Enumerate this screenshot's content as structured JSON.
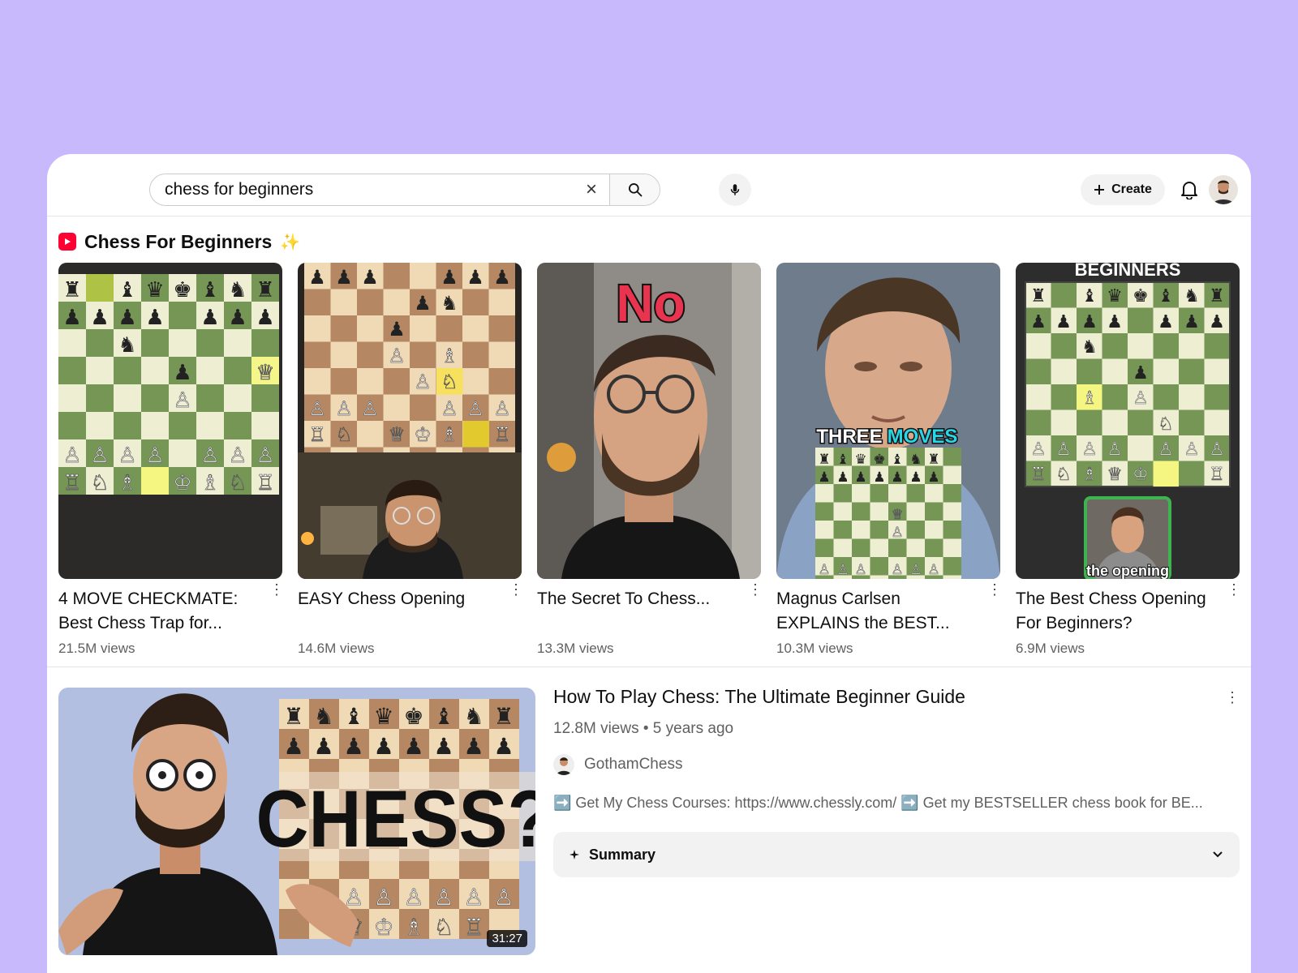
{
  "search": {
    "value": "chess for beginners",
    "clear_icon": "×"
  },
  "header": {
    "create_label": "Create"
  },
  "shelf": {
    "title": "Chess For Beginners",
    "sparkle": "✨",
    "items": [
      {
        "title": "4 MOVE CHECKMATE: Best Chess Trap for...",
        "views": "21.5M views"
      },
      {
        "title": "EASY Chess Opening",
        "views": "14.6M views"
      },
      {
        "title": "The Secret To Chess...",
        "views": "13.3M views",
        "overlay": "No"
      },
      {
        "title": "Magnus Carlsen EXPLAINS the BEST...",
        "views": "10.3M views",
        "overlay1": "THREE",
        "overlay2": "MOVES"
      },
      {
        "title": "The Best Chess Opening For Beginners?",
        "views": "6.9M views",
        "overlay_top": "BEGINNERS",
        "overlay_bottom": "the opening"
      }
    ]
  },
  "video": {
    "title": "How To Play Chess: The Ultimate Beginner Guide",
    "meta": "12.8M views • 5 years ago",
    "channel": "GothamChess",
    "description": "➡️ Get My Chess Courses: https://www.chessly.com/ ➡️ Get my BESTSELLER chess book for BE...",
    "duration": "31:27",
    "thumb_text": "CHESS?",
    "summary_label": "Summary"
  },
  "colors": {
    "background": "#c8b9fd",
    "board_light": "#eeeed2",
    "board_dark": "#769656",
    "wood_light": "#f0d9b5",
    "wood_dark": "#b58863"
  }
}
